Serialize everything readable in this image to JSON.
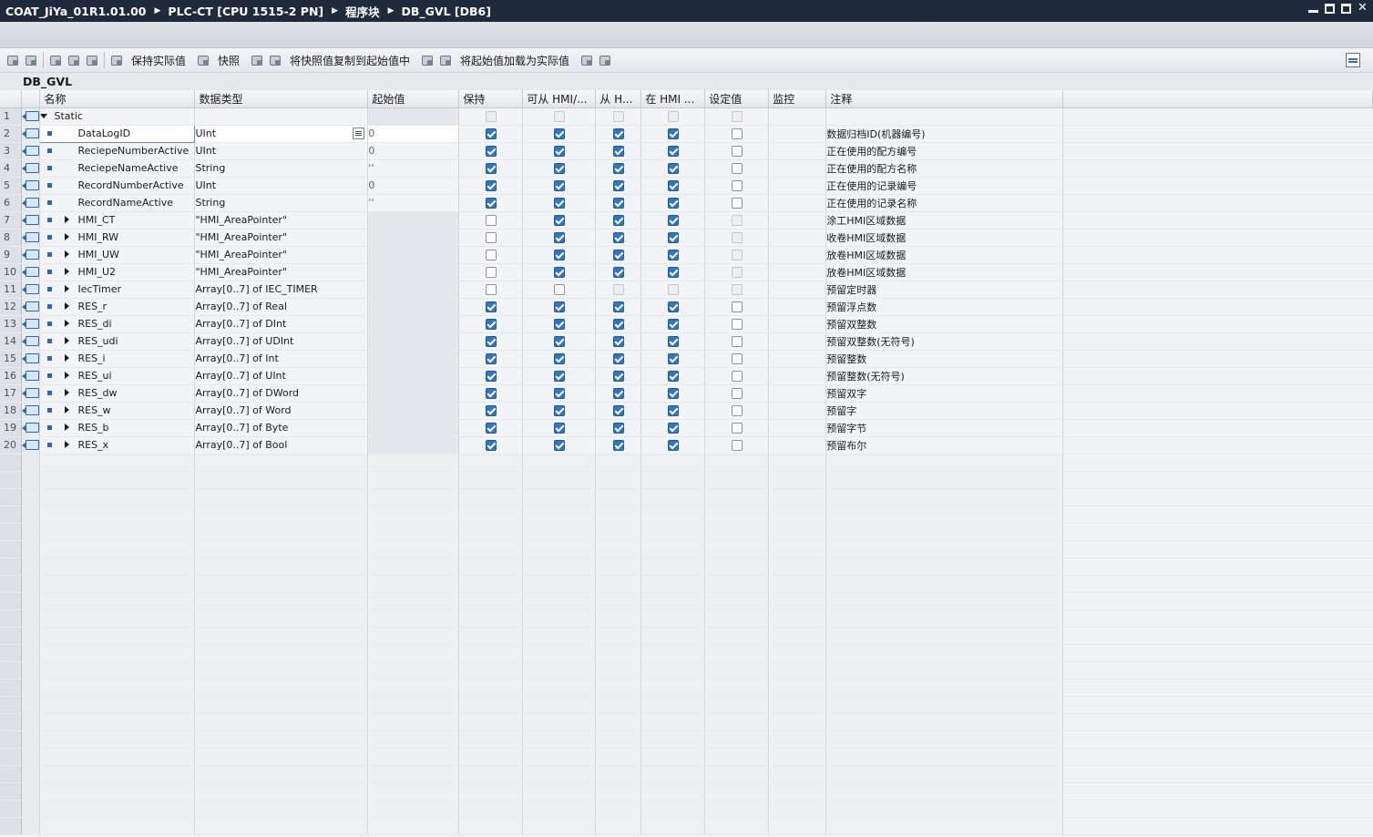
{
  "title_bar": {
    "crumbs": [
      "COAT_JiYa_01R1.01.00",
      "PLC-CT [CPU 1515-2 PN]",
      "程序块",
      "DB_GVL [DB6]"
    ]
  },
  "toolbar": {
    "keep_actual": "保持实际值",
    "snapshot": "快照",
    "copy_snapshot": "将快照值复制到起始值中",
    "load_start": "将起始值加载为实际值"
  },
  "db_title": "DB_GVL",
  "columns": {
    "name": "名称",
    "data_type": "数据类型",
    "start_value": "起始值",
    "retain": "保持",
    "accessible_hmi": "可从 HMI/...",
    "writable_hmi": "从 H...",
    "visible_hmi": "在 HMI ...",
    "setpoint": "设定值",
    "monitor": "监控",
    "comment": "注释"
  },
  "rows": [
    {
      "n": "1",
      "name": "Static",
      "type": "",
      "start": "",
      "expand": "down",
      "indent": 0,
      "c": [
        "d",
        "d",
        "d",
        "d",
        "d"
      ],
      "comment": ""
    },
    {
      "n": "2",
      "name": "DataLogID",
      "type": "UInt",
      "start": "0",
      "expand": "",
      "indent": 1,
      "c": [
        "on",
        "on",
        "on",
        "on",
        "off"
      ],
      "comment": "数据归档ID(机器编号)"
    },
    {
      "n": "3",
      "name": "ReciepeNumberActive",
      "type": "UInt",
      "start": "0",
      "expand": "",
      "indent": 1,
      "c": [
        "on",
        "on",
        "on",
        "on",
        "off"
      ],
      "comment": "正在使用的配方编号"
    },
    {
      "n": "4",
      "name": "ReciepeNameActive",
      "type": "String",
      "start": "''",
      "expand": "",
      "indent": 1,
      "c": [
        "on",
        "on",
        "on",
        "on",
        "off"
      ],
      "comment": "正在使用的配方名称"
    },
    {
      "n": "5",
      "name": "RecordNumberActive",
      "type": "UInt",
      "start": "0",
      "expand": "",
      "indent": 1,
      "c": [
        "on",
        "on",
        "on",
        "on",
        "off"
      ],
      "comment": "正在使用的记录编号"
    },
    {
      "n": "6",
      "name": "RecordNameActive",
      "type": "String",
      "start": "''",
      "expand": "",
      "indent": 1,
      "c": [
        "on",
        "on",
        "on",
        "on",
        "off"
      ],
      "comment": "正在使用的记录名称"
    },
    {
      "n": "7",
      "name": "HMI_CT",
      "type": "\"HMI_AreaPointer\"",
      "start": "",
      "expand": "right",
      "indent": 1,
      "c": [
        "off",
        "on",
        "on",
        "on",
        "d"
      ],
      "comment": "涂工HMI区域数据"
    },
    {
      "n": "8",
      "name": "HMI_RW",
      "type": "\"HMI_AreaPointer\"",
      "start": "",
      "expand": "right",
      "indent": 1,
      "c": [
        "off",
        "on",
        "on",
        "on",
        "d"
      ],
      "comment": "收卷HMI区域数据"
    },
    {
      "n": "9",
      "name": "HMI_UW",
      "type": "\"HMI_AreaPointer\"",
      "start": "",
      "expand": "right",
      "indent": 1,
      "c": [
        "off",
        "on",
        "on",
        "on",
        "d"
      ],
      "comment": "放卷HMI区域数据"
    },
    {
      "n": "10",
      "name": "HMI_U2",
      "type": "\"HMI_AreaPointer\"",
      "start": "",
      "expand": "right",
      "indent": 1,
      "c": [
        "off",
        "on",
        "on",
        "on",
        "d"
      ],
      "comment": "放卷HMI区域数据"
    },
    {
      "n": "11",
      "name": "IecTimer",
      "type": "Array[0..7] of IEC_TIMER",
      "start": "",
      "expand": "right",
      "indent": 1,
      "c": [
        "off",
        "off",
        "d",
        "d",
        "d"
      ],
      "comment": "预留定时器"
    },
    {
      "n": "12",
      "name": "RES_r",
      "type": "Array[0..7] of Real",
      "start": "",
      "expand": "right",
      "indent": 1,
      "c": [
        "on",
        "on",
        "on",
        "on",
        "off"
      ],
      "comment": "预留浮点数"
    },
    {
      "n": "13",
      "name": "RES_di",
      "type": "Array[0..7] of DInt",
      "start": "",
      "expand": "right",
      "indent": 1,
      "c": [
        "on",
        "on",
        "on",
        "on",
        "off"
      ],
      "comment": "预留双整数"
    },
    {
      "n": "14",
      "name": "RES_udi",
      "type": "Array[0..7] of UDInt",
      "start": "",
      "expand": "right",
      "indent": 1,
      "c": [
        "on",
        "on",
        "on",
        "on",
        "off"
      ],
      "comment": "预留双整数(无符号)"
    },
    {
      "n": "15",
      "name": "RES_i",
      "type": "Array[0..7] of Int",
      "start": "",
      "expand": "right",
      "indent": 1,
      "c": [
        "on",
        "on",
        "on",
        "on",
        "off"
      ],
      "comment": "预留整数"
    },
    {
      "n": "16",
      "name": "RES_ui",
      "type": "Array[0..7] of UInt",
      "start": "",
      "expand": "right",
      "indent": 1,
      "c": [
        "on",
        "on",
        "on",
        "on",
        "off"
      ],
      "comment": "预留整数(无符号)"
    },
    {
      "n": "17",
      "name": "RES_dw",
      "type": "Array[0..7] of DWord",
      "start": "",
      "expand": "right",
      "indent": 1,
      "c": [
        "on",
        "on",
        "on",
        "on",
        "off"
      ],
      "comment": "预留双字"
    },
    {
      "n": "18",
      "name": "RES_w",
      "type": "Array[0..7] of Word",
      "start": "",
      "expand": "right",
      "indent": 1,
      "c": [
        "on",
        "on",
        "on",
        "on",
        "off"
      ],
      "comment": "预留字"
    },
    {
      "n": "19",
      "name": "RES_b",
      "type": "Array[0..7] of Byte",
      "start": "",
      "expand": "right",
      "indent": 1,
      "c": [
        "on",
        "on",
        "on",
        "on",
        "off"
      ],
      "comment": "预留字节"
    },
    {
      "n": "20",
      "name": "RES_x",
      "type": "Array[0..7] of Bool",
      "start": "",
      "expand": "right",
      "indent": 1,
      "c": [
        "on",
        "on",
        "on",
        "on",
        "off"
      ],
      "comment": "预留布尔"
    }
  ]
}
